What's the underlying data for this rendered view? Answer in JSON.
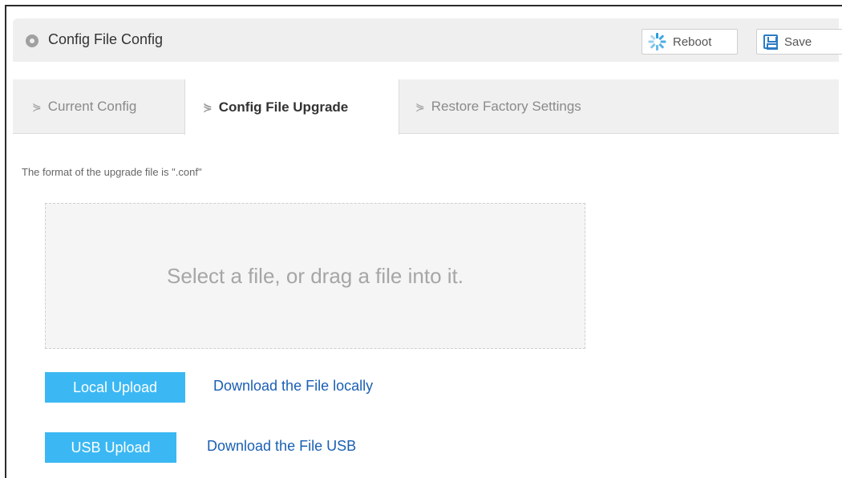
{
  "header": {
    "title": "Config File Config",
    "reboot_label": "Reboot",
    "save_label": "Save"
  },
  "tabs": [
    {
      "label": "Current Config",
      "active": false
    },
    {
      "label": "Config File Upgrade",
      "active": true
    },
    {
      "label": "Restore Factory Settings",
      "active": false
    }
  ],
  "upgrade": {
    "hint": "The format of the upgrade file is \".conf\"",
    "dropzone_text": "Select a file, or drag a file into it.",
    "local_upload_label": "Local Upload",
    "local_download_label": "Download the File locally",
    "usb_upload_label": "USB Upload",
    "usb_download_label": "Download the File USB"
  },
  "colors": {
    "accent": "#3bb8f3",
    "link": "#1a5fb4",
    "reboot_icon": "#2b9de0",
    "save_icon": "#2b7bc4"
  },
  "icons": {
    "header": "location-pin-icon",
    "reboot": "reboot-spinner-icon",
    "save": "floppy-save-icon",
    "tab": "chevron-right-icon"
  }
}
